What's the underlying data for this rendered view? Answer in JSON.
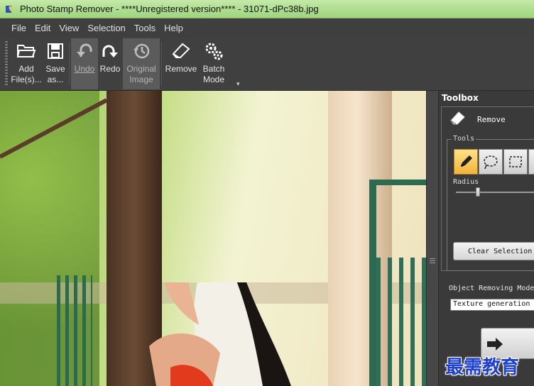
{
  "window": {
    "title": "Photo Stamp Remover - ****Unregistered version**** - 31071-dPc38b.jpg"
  },
  "menu": [
    "File",
    "Edit",
    "View",
    "Selection",
    "Tools",
    "Help"
  ],
  "toolbar": {
    "add_files": {
      "line1": "Add",
      "line2": "File(s)..."
    },
    "save_as": {
      "line1": "Save",
      "line2": "as..."
    },
    "undo": "Undo",
    "redo": "Redo",
    "original_image": {
      "line1": "Original",
      "line2": "Image"
    },
    "remove": "Remove",
    "batch_mode": {
      "line1": "Batch",
      "line2": "Mode"
    },
    "more": "▾"
  },
  "toolbox": {
    "header": "Toolbox",
    "remove_label": "Remove",
    "tools_legend": "Tools",
    "radius_label": "Radius",
    "radius_level": 0.28,
    "clear_selection": "Clear Selection",
    "object_removing_mode_label": "Object Removing Mode",
    "object_removing_mode_value": "Texture generation"
  },
  "watermark": "最需教育",
  "colors": {
    "titlebar": "#a9da88",
    "accent_tool": "#f2b33a",
    "watermark": "#1f3fcf"
  }
}
